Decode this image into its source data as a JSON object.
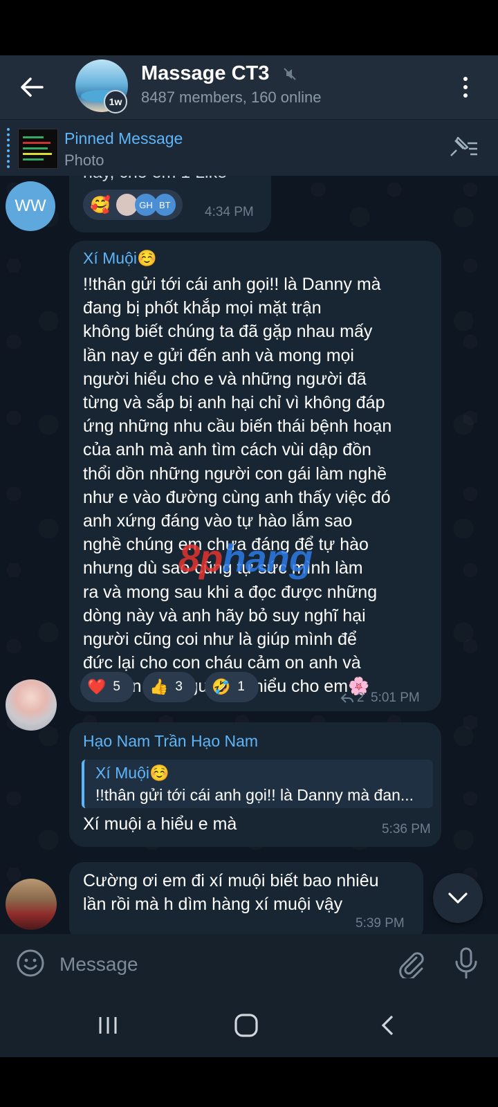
{
  "header": {
    "title": "Massage CT3",
    "badge": "1w",
    "subtitle": "8487 members, 160 online"
  },
  "pinned": {
    "title": "Pinned Message",
    "subtitle": "Photo"
  },
  "messages": [
    {
      "avatar_initials": "WW",
      "text_partial": "nay, cho em 1 Like",
      "reaction_initials": [
        "GH",
        "BT"
      ],
      "time": "4:34 PM"
    },
    {
      "sender": "Xí Muội☺️",
      "text": "!!thân gửi tới cái anh gọi!! là Danny mà\nđang bị phốt khắp mọi mặt trận\nkhông biết chúng ta đã gặp nhau mấy\nlần nay e gửi đến anh và mong mọi\nngười hiểu cho e và những người đã\ntừng và sắp bị anh hại chỉ vì không đáp\nứng những nhu cầu biến thái bệnh hoạn\ncủa anh mà anh tìm cách vùi dập đồn\nthổi dồn những người con gái làm nghề\nnhư e vào đường cùng anh thấy việc đó\nanh xứng đáng vào tự hào lắm sao\nnghề chúng em chưa đáng để tự hào\nnhưng dù sao cũng tự sức mình làm\nra và mong sau khi a đọc được những\ndòng này và anh hãy bỏ suy nghĩ hại\nngười cũng coi như là giúp mình để\nđức lại cho con cháu cảm on anh và\ncảm ơn mọi người đã hiểu cho em🌸",
      "reactions": [
        {
          "emoji": "❤️",
          "count": "5"
        },
        {
          "emoji": "👍",
          "count": "3"
        },
        {
          "emoji": "🤣",
          "count": "1"
        }
      ],
      "replies": "2",
      "time": "5:01 PM"
    },
    {
      "sender": "Hạo Nam Trần Hạo Nam",
      "quote_sender": "Xí Muội☺️",
      "quote_text": "!!thân gửi tới cái anh gọi!! là Danny mà đan...",
      "text": "Xí muội a hiểu e mà",
      "time": "5:36 PM"
    },
    {
      "text": "Cường ơi em đi xí muội biết bao nhiêu\nlần rồi mà h dìm hàng xí muội vậy",
      "time": "5:39 PM"
    }
  ],
  "watermark": {
    "part1": "8p",
    "part2": "hang"
  },
  "composer": {
    "placeholder": "Message"
  },
  "colors": {
    "header_bg": "#212d3b",
    "chat_bg": "#0e1621",
    "bubble_bg": "#182533",
    "accent": "#5eb5f7"
  }
}
